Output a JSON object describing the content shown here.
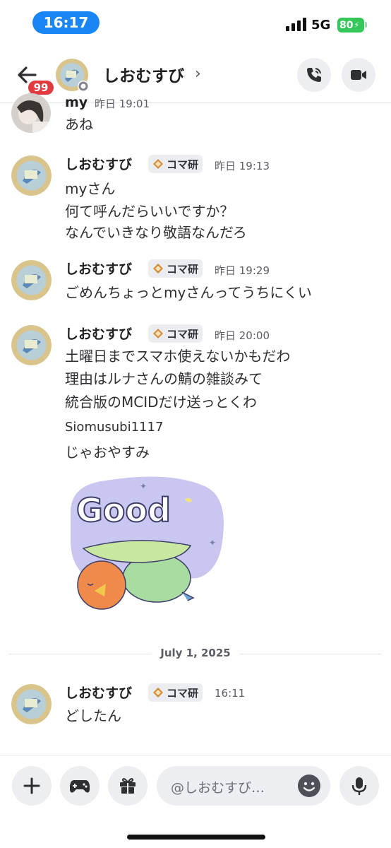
{
  "status_bar": {
    "time": "16:17",
    "network": "5G",
    "battery": "80"
  },
  "header": {
    "back_badge": "99",
    "title": "しおむすび",
    "chevron": "›",
    "call_icon": "phone-call-icon",
    "video_icon": "video-camera-icon"
  },
  "messages": [
    {
      "author": "my",
      "time": "昨日 19:01",
      "lines": [
        "あね"
      ]
    },
    {
      "author": "しおむすび",
      "tag": "コマ研",
      "time": "昨日 19:13",
      "lines": [
        "myさん",
        "何て呼んだらいいですか？",
        "なんでいきなり敬語なんだろ"
      ]
    },
    {
      "author": "しおむすび",
      "tag": "コマ研",
      "time": "昨日 19:29",
      "lines": [
        "ごめんちょっとmyさんってうちにくい"
      ]
    },
    {
      "author": "しおむすび",
      "tag": "コマ研",
      "time": "昨日 20:00",
      "lines": [
        "土曜日までスマホ使えないかもだわ",
        "理由はルナさんの鯖の雑談みて",
        "統合版のMCIDだけ送っとくわ",
        "Siomusubi1117",
        "じゃおやすみ"
      ],
      "sticker_text": "Good"
    },
    {
      "author": "しおむすび",
      "tag": "コマ研",
      "time": "16:11",
      "lines": [
        "どしたん"
      ]
    }
  ],
  "date_divider": "July 1, 2025",
  "composer": {
    "placeholder": "@しおむすび…",
    "plus_icon": "plus-icon",
    "game_icon": "gamepad-icon",
    "gift_icon": "gift-icon",
    "emoji_icon": "emoji-icon",
    "mic_icon": "microphone-icon"
  },
  "colors": {
    "accent_blue": "#1a86f5",
    "badge_red": "#e23b3f",
    "battery_green": "#34c759"
  }
}
